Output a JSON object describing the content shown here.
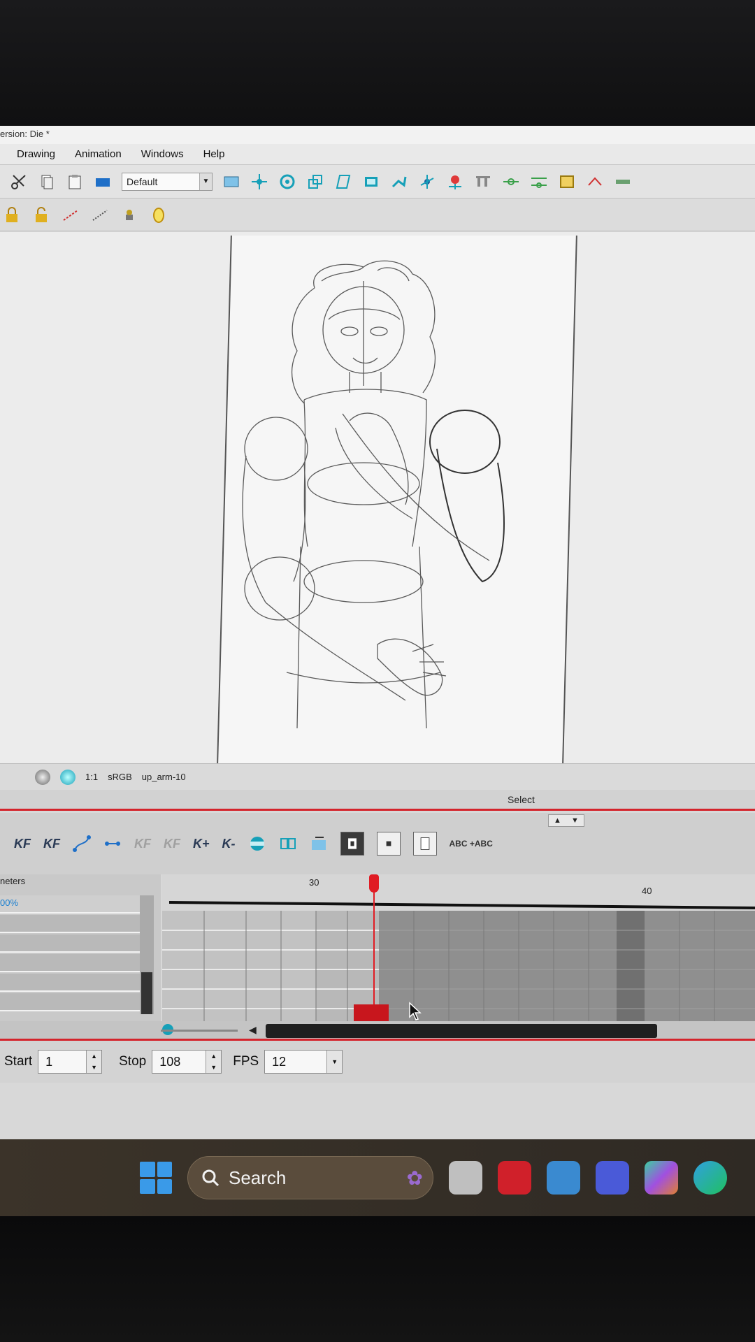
{
  "window": {
    "title": "ersion: Die *"
  },
  "menu": {
    "items": [
      "Drawing",
      "Animation",
      "Windows",
      "Help"
    ]
  },
  "toolbar": {
    "preset": "Default"
  },
  "camera_status": {
    "zoom": "1:1",
    "color_space": "sRGB",
    "drawing_name": "up_arm-10"
  },
  "mode": {
    "label": "Select"
  },
  "timeline_toolbar": {
    "add_keyframe": "KF",
    "remove_keyframe": "KF",
    "set_key_in": "K+",
    "set_key_out": "K-",
    "abc_label": "ABC +ABC"
  },
  "layer_panel": {
    "title": "neters",
    "opacity": "00%"
  },
  "timeline": {
    "ruler_labels": [
      "30",
      "40"
    ],
    "current_frame": 32
  },
  "playback": {
    "start_label": "Start",
    "start_value": "1",
    "stop_label": "Stop",
    "stop_value": "108",
    "fps_label": "FPS",
    "fps_value": "12"
  },
  "taskbar": {
    "search_label": "Search"
  },
  "colors": {
    "accent_red": "#d4242c",
    "toolbar_teal": "#16a0b8",
    "start_blue": "#3a9ae8"
  },
  "icons": [
    "scissors-icon",
    "copy-icon",
    "paste-icon",
    "lock-icon",
    "unlock-icon",
    "camera-icon",
    "search-icon",
    "windows-start-icon"
  ]
}
